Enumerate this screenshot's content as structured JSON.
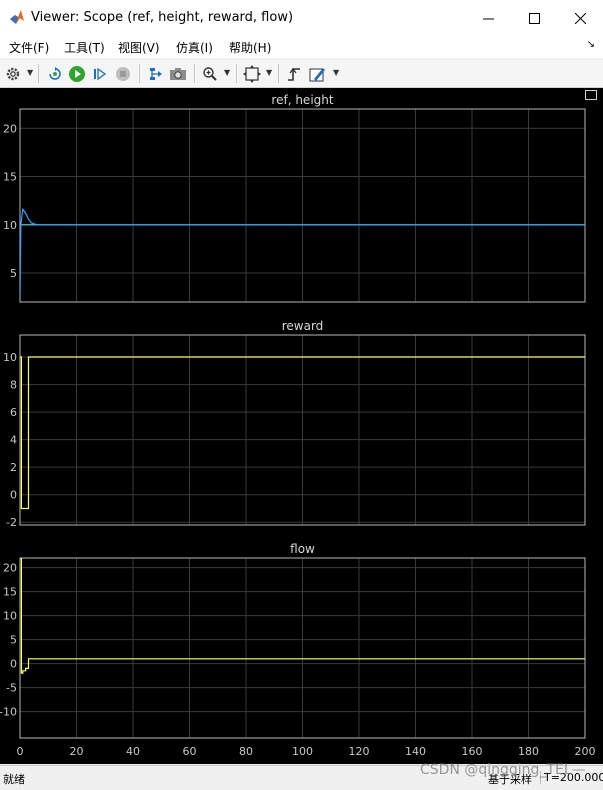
{
  "window": {
    "title": "Viewer: Scope (ref, height, reward, flow)",
    "controls": {
      "minimize": "—",
      "maximize": "☐",
      "close": "✕"
    }
  },
  "menu": {
    "items": [
      "文件(F)",
      "工具(T)",
      "视图(V)",
      "仿真(I)",
      "帮助(H)"
    ],
    "overflow_icon": "arrow-corner-icon"
  },
  "toolbar": {
    "icons": [
      "gear-icon",
      "step-back-icon",
      "run-icon",
      "step-forward-icon",
      "stop-icon",
      "highlight-icon",
      "snapshot-icon",
      "zoom-in-icon",
      "fit-axes-icon",
      "trigger-icon",
      "style-icon"
    ]
  },
  "colors": {
    "background": "#000000",
    "axes_border": "#b8b8b8",
    "grid": "#3a3a3a",
    "tick_text": "#c8c8c8",
    "line_blue": "#2ea3ff",
    "line_cyan": "#4ee0e0",
    "line_yellow": "#ffff66"
  },
  "status": {
    "left": "就绪",
    "mid": "基于采样",
    "time": "T=200.000"
  },
  "watermark": "CSDN @qingqing_TEL—",
  "chart_data": [
    {
      "type": "line",
      "title": "ref, height",
      "xlim": [
        0,
        200
      ],
      "ylim": [
        2,
        22
      ],
      "yticks": [
        5,
        10,
        15,
        20
      ],
      "grid": true,
      "series": [
        {
          "color": "#2ea3ff",
          "x": [
            0,
            0.3,
            1,
            2,
            3,
            4,
            6,
            10,
            200
          ],
          "y": [
            2.5,
            10,
            11.6,
            11.2,
            10.6,
            10.2,
            10.0,
            10.0,
            10.0
          ]
        },
        {
          "color": "#4ee0e0",
          "x": [
            0,
            200
          ],
          "y": [
            10,
            10
          ]
        }
      ]
    },
    {
      "type": "line",
      "title": "reward",
      "xlim": [
        0,
        200
      ],
      "ylim": [
        -2.2,
        11.6
      ],
      "yticks": [
        -2,
        0,
        2,
        4,
        6,
        8,
        10
      ],
      "grid": true,
      "series": [
        {
          "color": "#ffff66",
          "x": [
            0,
            0.5,
            0.5,
            3,
            3,
            200
          ],
          "y": [
            10,
            10,
            -1,
            -1,
            10,
            10
          ]
        }
      ]
    },
    {
      "type": "line",
      "title": "flow",
      "xlim": [
        0,
        200
      ],
      "ylim": [
        -15.5,
        22
      ],
      "yticks": [
        -10,
        -5,
        0,
        5,
        10,
        15,
        20
      ],
      "xticks": [
        0,
        20,
        40,
        60,
        80,
        100,
        120,
        140,
        160,
        180,
        200
      ],
      "grid": true,
      "series": [
        {
          "color": "#ffff66",
          "x": [
            0,
            0.5,
            0.5,
            1,
            1,
            2,
            2,
            3,
            3,
            200
          ],
          "y": [
            22,
            22,
            -2,
            -2,
            -1.5,
            -1.5,
            -1,
            -1,
            1,
            1
          ]
        }
      ]
    }
  ]
}
